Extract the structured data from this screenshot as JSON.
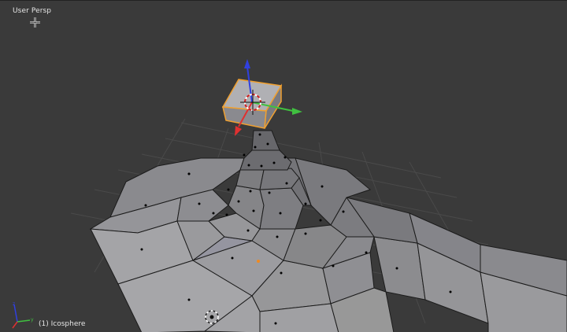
{
  "viewport": {
    "view_name": "User Persp",
    "object_info": "(1) Icosphere"
  },
  "colors": {
    "background": "#3a3a3a",
    "grid": "#4a4a4a",
    "mesh_face": "#8f8f92",
    "mesh_face_dark": "#6f6f72",
    "mesh_edge": "#1b1b1b",
    "selected_outline": "#f0a030",
    "axis_x": "#e03030",
    "axis_y": "#40c040",
    "axis_z": "#3040e0"
  },
  "icons": [
    "3d-cursor-icon",
    "crosshair-cursor-icon",
    "axis-orientation-icon"
  ]
}
